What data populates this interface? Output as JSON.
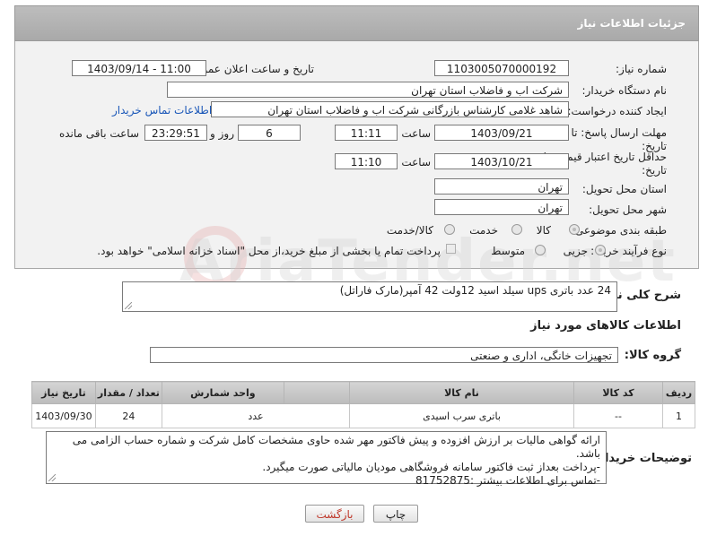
{
  "header": {
    "title": "جزئیات اطلاعات نیاز"
  },
  "fields": {
    "need_number_label": "شماره نیاز:",
    "need_number": "1103005070000192",
    "announce_label": "تاریخ و ساعت اعلان عمومی:",
    "announce_value": "1403/09/14 - 11:00",
    "buyer_org_label": "نام دستگاه خریدار:",
    "buyer_org": "شرکت اب و فاضلاب استان تهران",
    "requester_label": "ایجاد کننده درخواست:",
    "requester": "شاهد غلامی کارشناس بازرگانی شرکت اب و فاضلاب استان تهران",
    "contact_link": "اطلاعات تماس خریدار",
    "deadline_label": "مهلت ارسال پاسخ: تا تاریخ:",
    "deadline_date": "1403/09/21",
    "time_label": "ساعت",
    "deadline_time": "11:11",
    "days_value": "6",
    "days_label": "روز و",
    "remaining_time": "23:29:51",
    "remaining_label": "ساعت باقی مانده",
    "validity_label": "حداقل تاریخ اعتبار قیمت: تا تاریخ:",
    "validity_date": "1403/10/21",
    "validity_time_label": "ساعت",
    "validity_time": "11:10",
    "province_label": "استان محل تحویل:",
    "province": "تهران",
    "city_label": "شهر محل تحویل:",
    "city": "تهران",
    "category_label": "طبقه بندی موضوعی:",
    "category_options": [
      "کالا",
      "خدمت",
      "کالا/خدمت"
    ],
    "process_label": "نوع فرآیند خرید :",
    "process_options": [
      "جزیی",
      "متوسط"
    ],
    "payment_note": "پرداخت تمام یا بخشی از مبلغ خرید،از محل \"اسناد خزانه اسلامی\" خواهد بود."
  },
  "summary": {
    "label": "شرح کلی نیاز:",
    "text": "24 عدد  باتری ups سیلد اسید 12ولت 42 آمپر(مارک فاراتل)"
  },
  "goods_info_title": "اطلاعات کالاهای مورد نیاز",
  "goods_group": {
    "label": "گروه کالا:",
    "value": "تجهیزات خانگی، اداری و صنعتی"
  },
  "table": {
    "headers": [
      "ردیف",
      "کد کالا",
      "نام کالا",
      "واحد شمارش",
      "تعداد / مقدار",
      "تاریخ نیاز"
    ],
    "rows": [
      [
        "1",
        "--",
        "باتری سرب اسیدی",
        "عدد",
        "24",
        "1403/09/30"
      ]
    ]
  },
  "buyer_notes": {
    "label": "توضیحات خریدار:",
    "lines": [
      "ارائه گواهی مالیات بر ارزش افزوده و  پیش فاکتور مهر شده حاوی مشخصات کامل شرکت و شماره حساب الزامی می باشد.",
      "-پرداخت بعداز ثبت فاکتور سامانه فروشگاهی مودیان مالیاتی صورت میگیرد.",
      "-تماس برای اطلاعات بیشتر :81752875"
    ]
  },
  "buttons": {
    "print": "چاپ",
    "back": "بازگشت"
  },
  "watermark": "AriaTender.net"
}
